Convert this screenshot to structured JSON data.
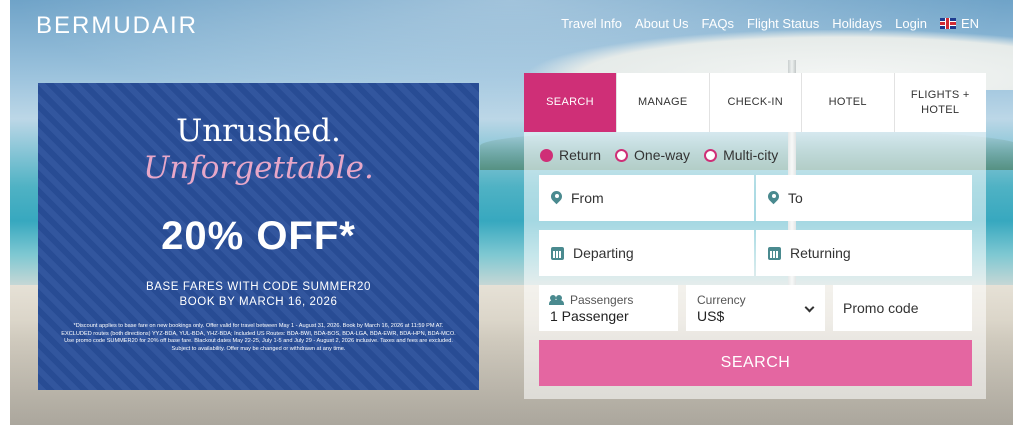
{
  "header": {
    "logo_text": "BERMUDAIR",
    "nav": [
      "Travel Info",
      "About Us",
      "FAQs",
      "Flight Status",
      "Holidays",
      "Login"
    ],
    "language": "EN"
  },
  "promo": {
    "line1": "Unrushed.",
    "line2": "Unforgettable.",
    "discount": "20% OFF*",
    "code_line": "BASE FARES WITH CODE SUMMER20",
    "book_by": "BOOK BY MARCH 16, 2026",
    "fine_print": "*Discount applies to base fare on new bookings only. Offer valid for travel between May 1 - August 31, 2026. Book by March 16, 2026 at 11:59 PM AT. EXCLUDED routes (both directions) YYZ-BDA, YUL-BDA, YHZ-BDA; Included US Routes: BDA-BWI, BDA-BOS, BDA-LGA, BDA-EWR, BDA-HPN, BDA-MCO. Use promo code SUMMER20 for 20% off base fare. Blackout dates May 22-25, July 1-5 and July 29 - August 2, 2026 inclusive. Taxes and fees are excluded. Subject to availability. Offer may be changed or withdrawn at any time."
  },
  "booking": {
    "tabs": [
      "SEARCH",
      "MANAGE",
      "CHECK-IN",
      "HOTEL",
      "FLIGHTS + HOTEL"
    ],
    "active_tab": "SEARCH",
    "trip_types": [
      "Return",
      "One-way",
      "Multi-city"
    ],
    "selected_trip": "Return",
    "from_placeholder": "From",
    "to_placeholder": "To",
    "departing_placeholder": "Departing",
    "returning_placeholder": "Returning",
    "passengers_label": "Passengers",
    "passengers_value": "1 Passenger",
    "currency_label": "Currency",
    "currency_value": "US$",
    "promo_placeholder": "Promo code",
    "search_button": "SEARCH"
  },
  "colors": {
    "accent_pink": "#cf2f77",
    "button_pink": "#e466a1",
    "promo_blue": "#2a4f9a",
    "icon_teal": "#4a8a8f"
  },
  "icons": [
    "location-pin-icon",
    "calendar-icon",
    "passengers-icon",
    "chevron-down-icon",
    "uk-flag-icon"
  ]
}
